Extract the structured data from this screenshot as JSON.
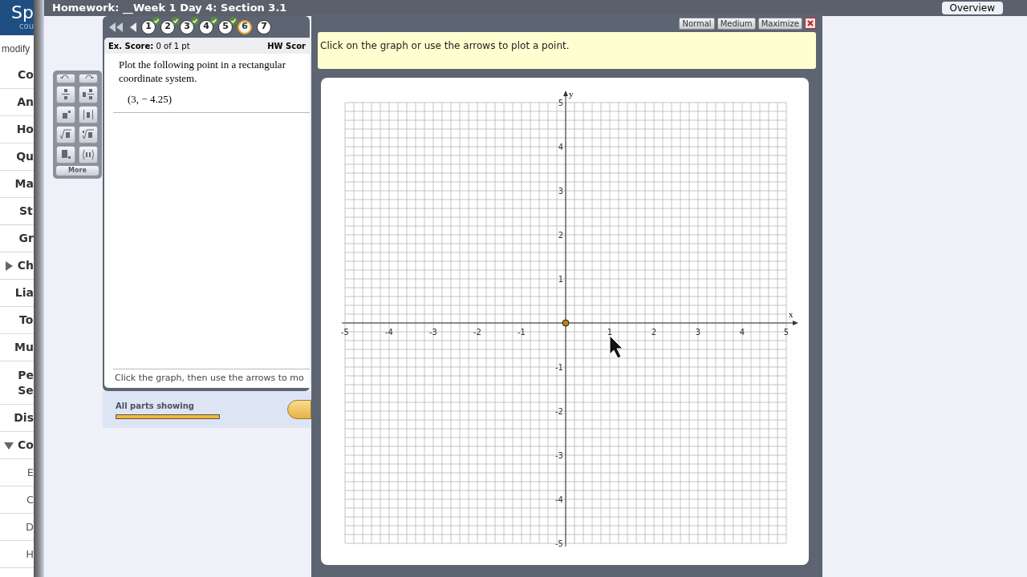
{
  "header": {
    "logo": "Sp",
    "logo_sub": "cou",
    "title": "Homework: __Week 1 Day 4: Section 3.1",
    "overview_button": "Overview"
  },
  "sidebar": {
    "modify": "modify",
    "items": [
      {
        "label": "Co",
        "kind": "link"
      },
      {
        "label": "An",
        "kind": "link"
      },
      {
        "label": "Ho",
        "kind": "link"
      },
      {
        "label": "Qu",
        "kind": "link"
      },
      {
        "label": "Ma",
        "kind": "link"
      },
      {
        "label": "St",
        "kind": "link"
      },
      {
        "label": "Gr",
        "kind": "link"
      },
      {
        "label": "Ch",
        "kind": "folder",
        "expanded": false
      },
      {
        "label": "Lia",
        "kind": "link"
      },
      {
        "label": "To",
        "kind": "link"
      },
      {
        "label": "Mu",
        "kind": "link"
      },
      {
        "label": "Pe",
        "label_2": "Se",
        "kind": "link"
      },
      {
        "label": "Dis",
        "kind": "link"
      },
      {
        "label": "Co",
        "kind": "folder",
        "expanded": true,
        "children": [
          {
            "label": "E"
          },
          {
            "label": "C"
          },
          {
            "label": "D"
          },
          {
            "label": "H"
          }
        ]
      }
    ]
  },
  "question_panel": {
    "questions": [
      {
        "label": "1",
        "done": true,
        "selected": false
      },
      {
        "label": "2",
        "done": true,
        "selected": false
      },
      {
        "label": "3",
        "done": true,
        "selected": false
      },
      {
        "label": "4",
        "done": true,
        "selected": false
      },
      {
        "label": "5",
        "done": true,
        "selected": false
      },
      {
        "label": "6",
        "done": false,
        "selected": true
      },
      {
        "label": "7",
        "done": false,
        "selected": false
      }
    ],
    "ex_score_label": "Ex. Score:",
    "ex_score": "0 of 1 pt",
    "hw_score_label": "HW Scor",
    "prompt": "Plot the following point in a rectangular coordinate system.",
    "point": "(3, − 4.25)",
    "hint": "Click the graph, then use the arrows to mo",
    "parts_label": "All parts showing",
    "parts_progress": {
      "level": 1
    }
  },
  "math_toolbar": {
    "more_button": "More"
  },
  "graph_window": {
    "buttons": [
      "Normal",
      "Medium",
      "Maximize"
    ],
    "instruction": "Click on the graph or use the arrows to plot a point.",
    "chart_data": {
      "type": "scatter",
      "grid": true,
      "xlabel": "x",
      "ylabel": "y",
      "xlim": [
        -5,
        5
      ],
      "ylim": [
        -5,
        5
      ],
      "xticks": [
        {
          "value": -5,
          "label": "-5"
        },
        {
          "value": -4,
          "label": "-4"
        },
        {
          "value": -3,
          "label": "-3"
        },
        {
          "value": -2,
          "label": "-2"
        },
        {
          "value": -1,
          "label": "-1"
        },
        {
          "value": 1,
          "label": "1"
        },
        {
          "value": 2,
          "label": "2"
        },
        {
          "value": 3,
          "label": "3"
        },
        {
          "value": 4,
          "label": "4"
        },
        {
          "value": 5,
          "label": "5"
        }
      ],
      "yticks": [
        {
          "value": -5,
          "label": "-5"
        },
        {
          "value": -4,
          "label": "-4"
        },
        {
          "value": -3,
          "label": "-3"
        },
        {
          "value": -2,
          "label": "-2"
        },
        {
          "value": -1,
          "label": "-1"
        },
        {
          "value": 1,
          "label": "1"
        },
        {
          "value": 2,
          "label": "2"
        },
        {
          "value": 3,
          "label": "3"
        },
        {
          "value": 4,
          "label": "4"
        },
        {
          "value": 5,
          "label": "5"
        }
      ],
      "x": [
        0
      ],
      "series": [
        {
          "color": "#b8860b",
          "values": [
            0
          ]
        }
      ]
    }
  }
}
